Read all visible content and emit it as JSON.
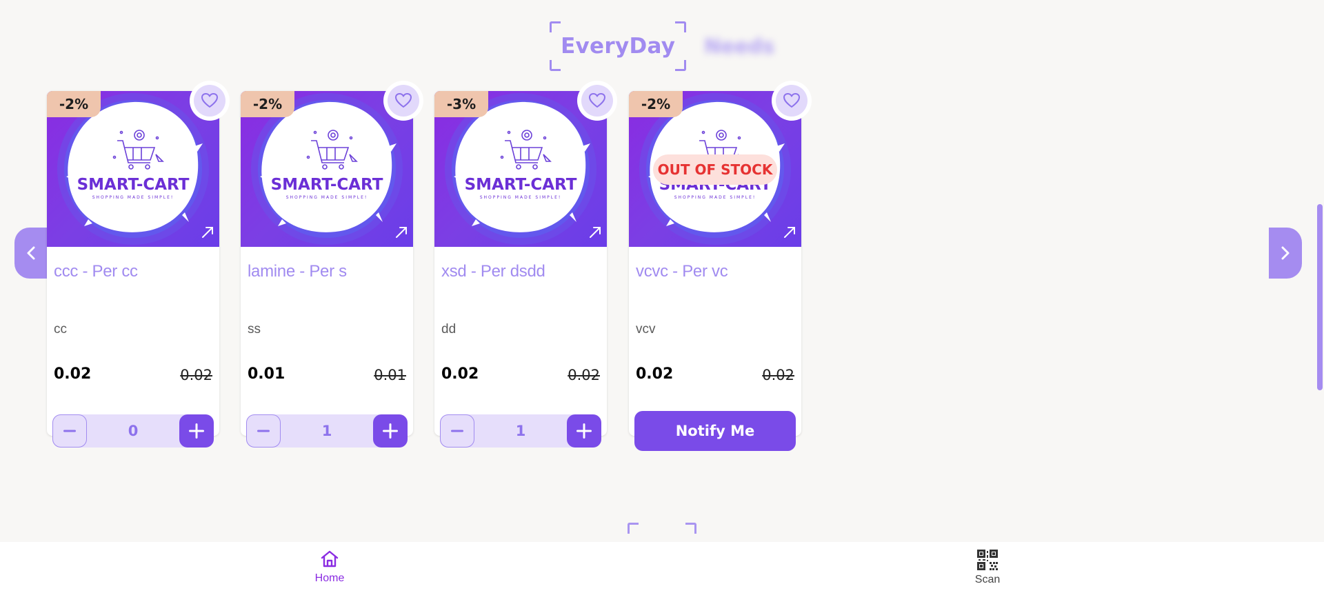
{
  "section": {
    "title": "EveryDay",
    "title_blurred": "Needs"
  },
  "colors": {
    "accent": "#7a4be8",
    "accent_light": "#a18bf0",
    "discount_bg": "#efc5ad",
    "out_of_stock": "#e63232"
  },
  "products": [
    {
      "discount": "-2%",
      "name": "ccc - Per cc",
      "description": "cc",
      "price": "0.02",
      "old_price": "0.02",
      "quantity": "0",
      "out_of_stock": false
    },
    {
      "discount": "-2%",
      "name": "lamine - Per s",
      "description": "ss",
      "price": "0.01",
      "old_price": "0.01",
      "quantity": "1",
      "out_of_stock": false
    },
    {
      "discount": "-3%",
      "name": "xsd - Per dsdd",
      "description": "dd",
      "price": "0.02",
      "old_price": "0.02",
      "quantity": "1",
      "out_of_stock": false
    },
    {
      "discount": "-2%",
      "name": "vcvc - Per vc",
      "description": "vcv",
      "price": "0.02",
      "old_price": "0.02",
      "quantity": null,
      "out_of_stock": true,
      "out_of_stock_label": "OUT OF STOCK",
      "notify_label": "Notify Me"
    }
  ],
  "logo": {
    "brand": "SMART-CART",
    "tagline": "SHOPPING MADE SIMPLE!"
  },
  "bottom_nav": {
    "home_label": "Home",
    "scan_label": "Scan"
  },
  "icons": [
    "chevron-left-icon",
    "chevron-right-icon",
    "heart-icon",
    "expand-icon",
    "minus-icon",
    "plus-icon",
    "home-icon",
    "qr-code-icon",
    "cart-icon"
  ]
}
